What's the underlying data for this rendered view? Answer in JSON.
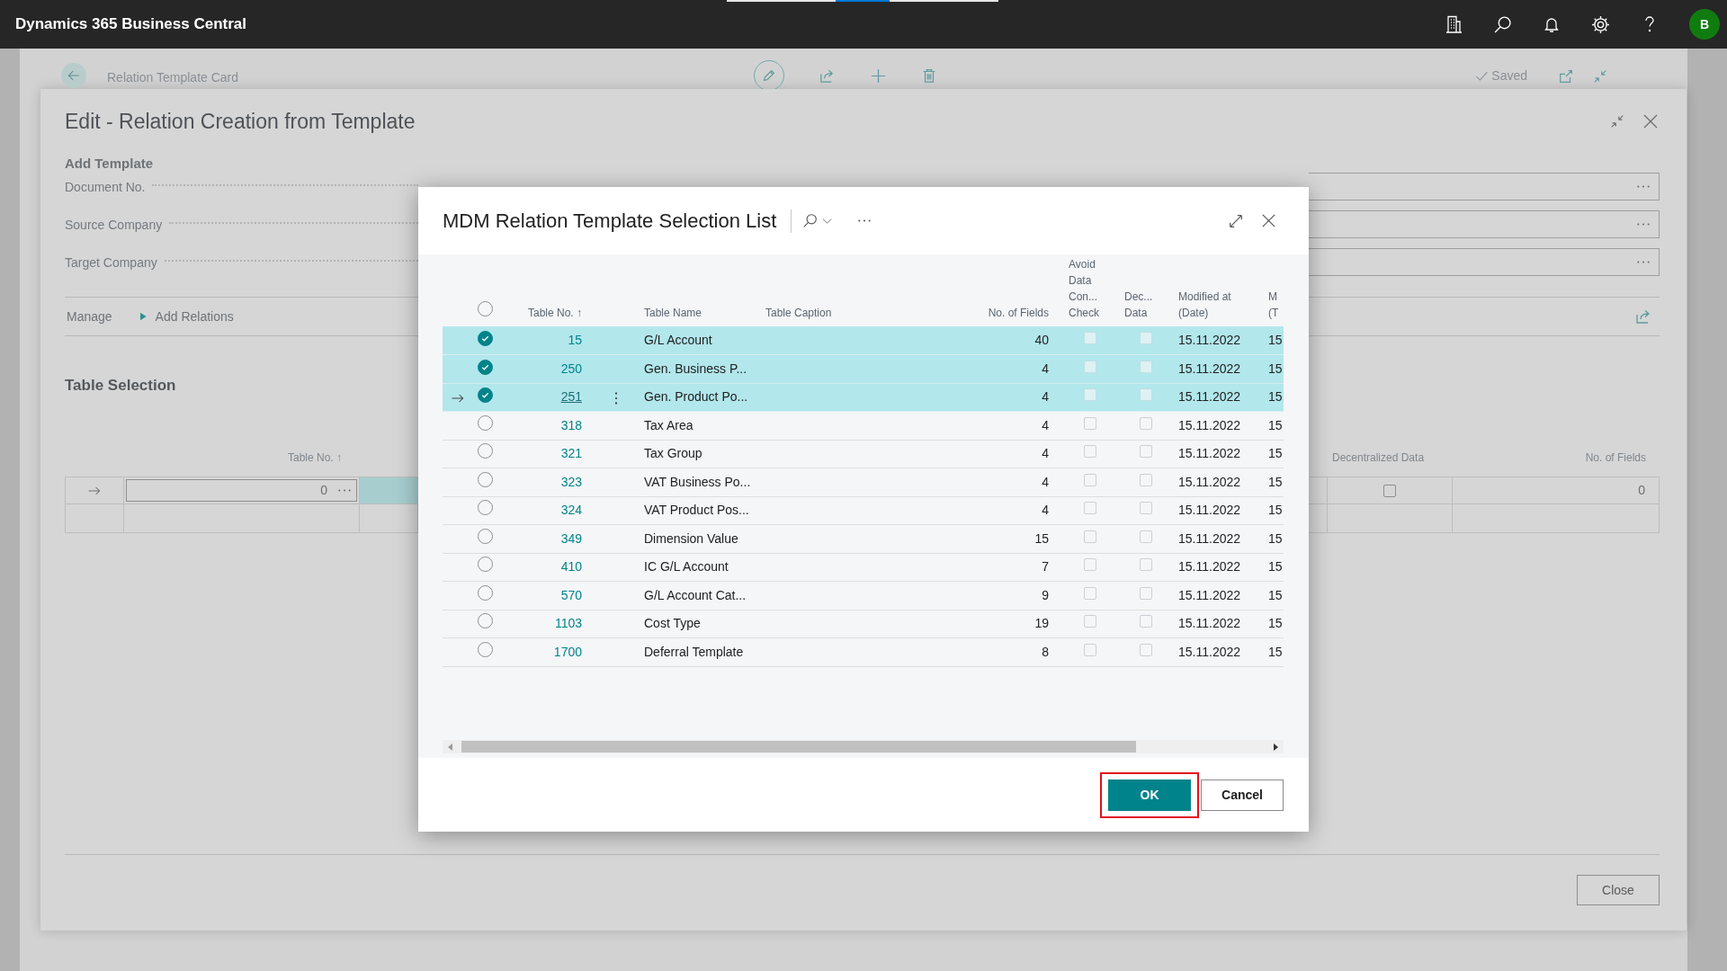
{
  "app_bar": {
    "title": "Dynamics 365 Business Central",
    "avatar": "B"
  },
  "page": {
    "title": "Relation Template Card",
    "status": "Saved"
  },
  "panel": {
    "title": "Edit - Relation Creation from Template",
    "section": "Add Template",
    "fields": [
      {
        "label": "Document No."
      },
      {
        "label": "Source Company"
      },
      {
        "label": "Target Company"
      }
    ],
    "menu": "Manage",
    "action": "Add Relations",
    "subpage_title": "Table Selection",
    "table": {
      "columns": [
        "Table No. ↑",
        "Decentralized Data",
        "No. of Fields"
      ],
      "rows": [
        {
          "current": true,
          "table_no": "0",
          "decentralized": false,
          "no_of_fields": "0"
        }
      ]
    },
    "close_button": "Close"
  },
  "dialog": {
    "title": "MDM Relation Template Selection List",
    "all_selected": false,
    "columns": [
      "Table No. ↑",
      "Table Name",
      "Table Caption",
      "No. of Fields",
      "Avoid Data Con... Check",
      "Dec... Data",
      "Modified at (Date)",
      "M (T"
    ],
    "rows": [
      {
        "selected": true,
        "current": false,
        "table_no": "15",
        "table_name": "G/L Account",
        "no_of_fields": "40",
        "avoid_check": false,
        "decentralized": false,
        "modified_date": "15.11.2022",
        "column_8": "15"
      },
      {
        "selected": true,
        "current": false,
        "table_no": "250",
        "table_name": "Gen. Business P...",
        "no_of_fields": "4",
        "avoid_check": false,
        "decentralized": false,
        "modified_date": "15.11.2022",
        "column_8": "15"
      },
      {
        "selected": true,
        "current": true,
        "table_no": "251",
        "table_name": "Gen. Product Po...",
        "no_of_fields": "4",
        "avoid_check": false,
        "decentralized": false,
        "modified_date": "15.11.2022",
        "column_8": "15"
      },
      {
        "selected": false,
        "current": false,
        "table_no": "318",
        "table_name": "Tax Area",
        "no_of_fields": "4",
        "avoid_check": false,
        "decentralized": false,
        "modified_date": "15.11.2022",
        "column_8": "15"
      },
      {
        "selected": false,
        "current": false,
        "table_no": "321",
        "table_name": "Tax Group",
        "no_of_fields": "4",
        "avoid_check": false,
        "decentralized": false,
        "modified_date": "15.11.2022",
        "column_8": "15"
      },
      {
        "selected": false,
        "current": false,
        "table_no": "323",
        "table_name": "VAT Business Po...",
        "no_of_fields": "4",
        "avoid_check": false,
        "decentralized": false,
        "modified_date": "15.11.2022",
        "column_8": "15"
      },
      {
        "selected": false,
        "current": false,
        "table_no": "324",
        "table_name": "VAT Product Pos...",
        "no_of_fields": "4",
        "avoid_check": false,
        "decentralized": false,
        "modified_date": "15.11.2022",
        "column_8": "15"
      },
      {
        "selected": false,
        "current": false,
        "table_no": "349",
        "table_name": "Dimension Value",
        "no_of_fields": "15",
        "avoid_check": false,
        "decentralized": false,
        "modified_date": "15.11.2022",
        "column_8": "15"
      },
      {
        "selected": false,
        "current": false,
        "table_no": "410",
        "table_name": "IC G/L Account",
        "no_of_fields": "7",
        "avoid_check": false,
        "decentralized": false,
        "modified_date": "15.11.2022",
        "column_8": "15"
      },
      {
        "selected": false,
        "current": false,
        "table_no": "570",
        "table_name": "G/L Account Cat...",
        "no_of_fields": "9",
        "avoid_check": false,
        "decentralized": false,
        "modified_date": "15.11.2022",
        "column_8": "15"
      },
      {
        "selected": false,
        "current": false,
        "table_no": "1103",
        "table_name": "Cost Type",
        "no_of_fields": "19",
        "avoid_check": false,
        "decentralized": false,
        "modified_date": "15.11.2022",
        "column_8": "15"
      },
      {
        "selected": false,
        "current": false,
        "table_no": "1700",
        "table_name": "Deferral Template",
        "no_of_fields": "8",
        "avoid_check": false,
        "decentralized": false,
        "modified_date": "15.11.2022",
        "column_8": "15"
      }
    ],
    "buttons": [
      {
        "label": "OK",
        "primary": true,
        "highlighted": true
      },
      {
        "label": "Cancel",
        "primary": false,
        "highlighted": false
      }
    ]
  }
}
